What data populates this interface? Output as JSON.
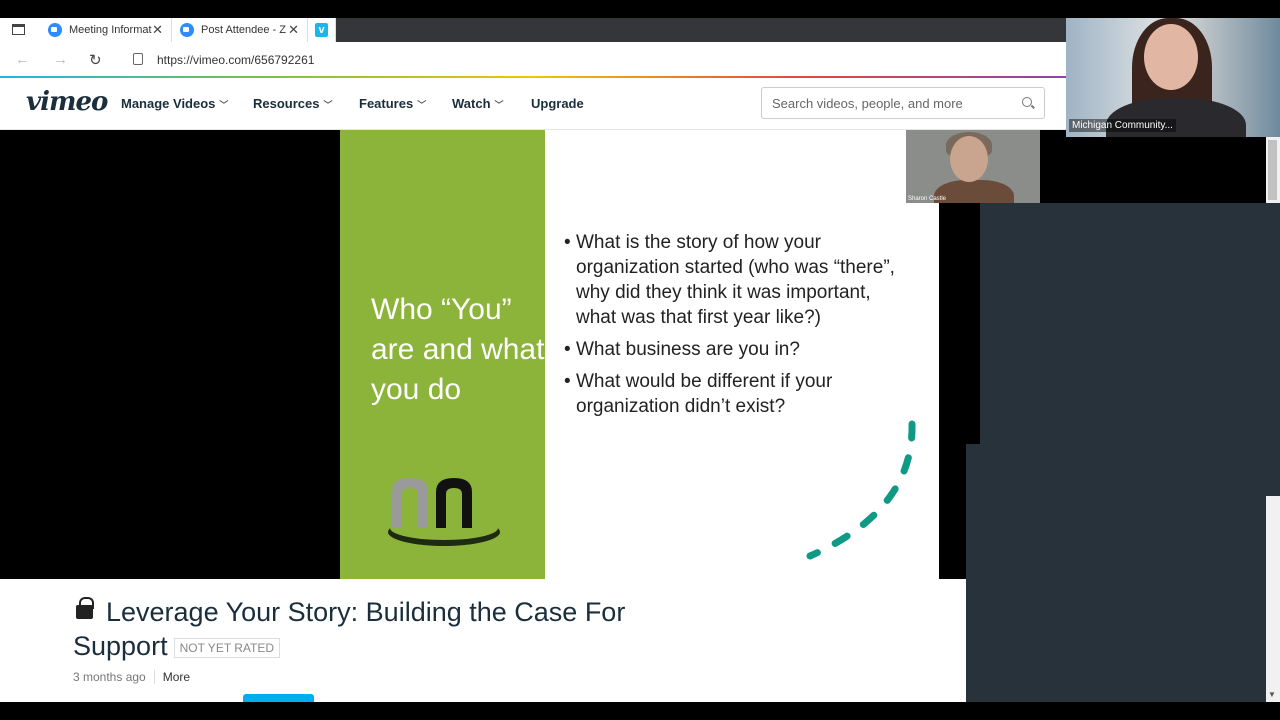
{
  "browser": {
    "tabs": [
      {
        "label": "Meeting Informat"
      },
      {
        "label": "Post Attendee - Z"
      }
    ],
    "close_glyph": "✕",
    "url": "https://vimeo.com/656792261"
  },
  "vimeo": {
    "logo": "vimeo",
    "nav": [
      {
        "label": "Manage Videos"
      },
      {
        "label": "Resources"
      },
      {
        "label": "Features"
      },
      {
        "label": "Watch"
      },
      {
        "label": "Upgrade"
      }
    ],
    "search_placeholder": "Search videos, people, and more"
  },
  "slide": {
    "title": "Who “You” are and what you do",
    "bullets": [
      "What is the story of how your organization started (who was “there”, why did they think it was important, what was that first year like?)",
      "What business are you in?",
      "What would be different if your organization didn’t exist?"
    ],
    "accent_color": "#8cb33a",
    "arc_color": "#109a86"
  },
  "presenter_thumb": {
    "name": "Sharon Castle"
  },
  "speaker": {
    "name": "Michigan Community..."
  },
  "video": {
    "title": "Leverage Your Story: Building the Case For Support",
    "rating": "NOT YET RATED",
    "age": "3 months ago",
    "more": "More"
  }
}
